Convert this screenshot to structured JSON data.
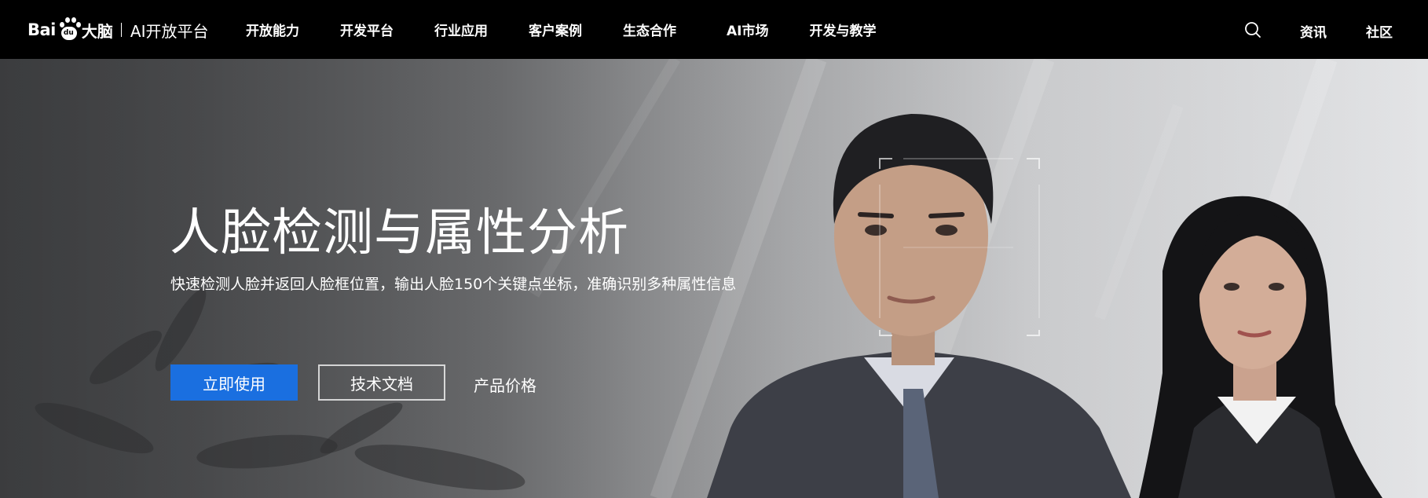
{
  "logo": {
    "bai": "Bai",
    "du": "du",
    "dano": "大脑",
    "platform": "AI开放平台"
  },
  "nav": {
    "items": [
      "开放能力",
      "开发平台",
      "行业应用",
      "客户案例",
      "生态合作",
      "AI市场",
      "开发与教学"
    ],
    "search_icon": "search-icon",
    "news": "资讯",
    "community": "社区"
  },
  "hero": {
    "title": "人脸检测与属性分析",
    "subtitle": "快速检测人脸并返回人脸框位置，输出人脸150个关键点坐标，准确识别多种属性信息",
    "primary_button": "立即使用",
    "secondary_button": "技术文档",
    "price_link": "产品价格"
  },
  "colors": {
    "navbar_bg": "#000000",
    "primary": "#1a6fe0",
    "text": "#ffffff"
  }
}
